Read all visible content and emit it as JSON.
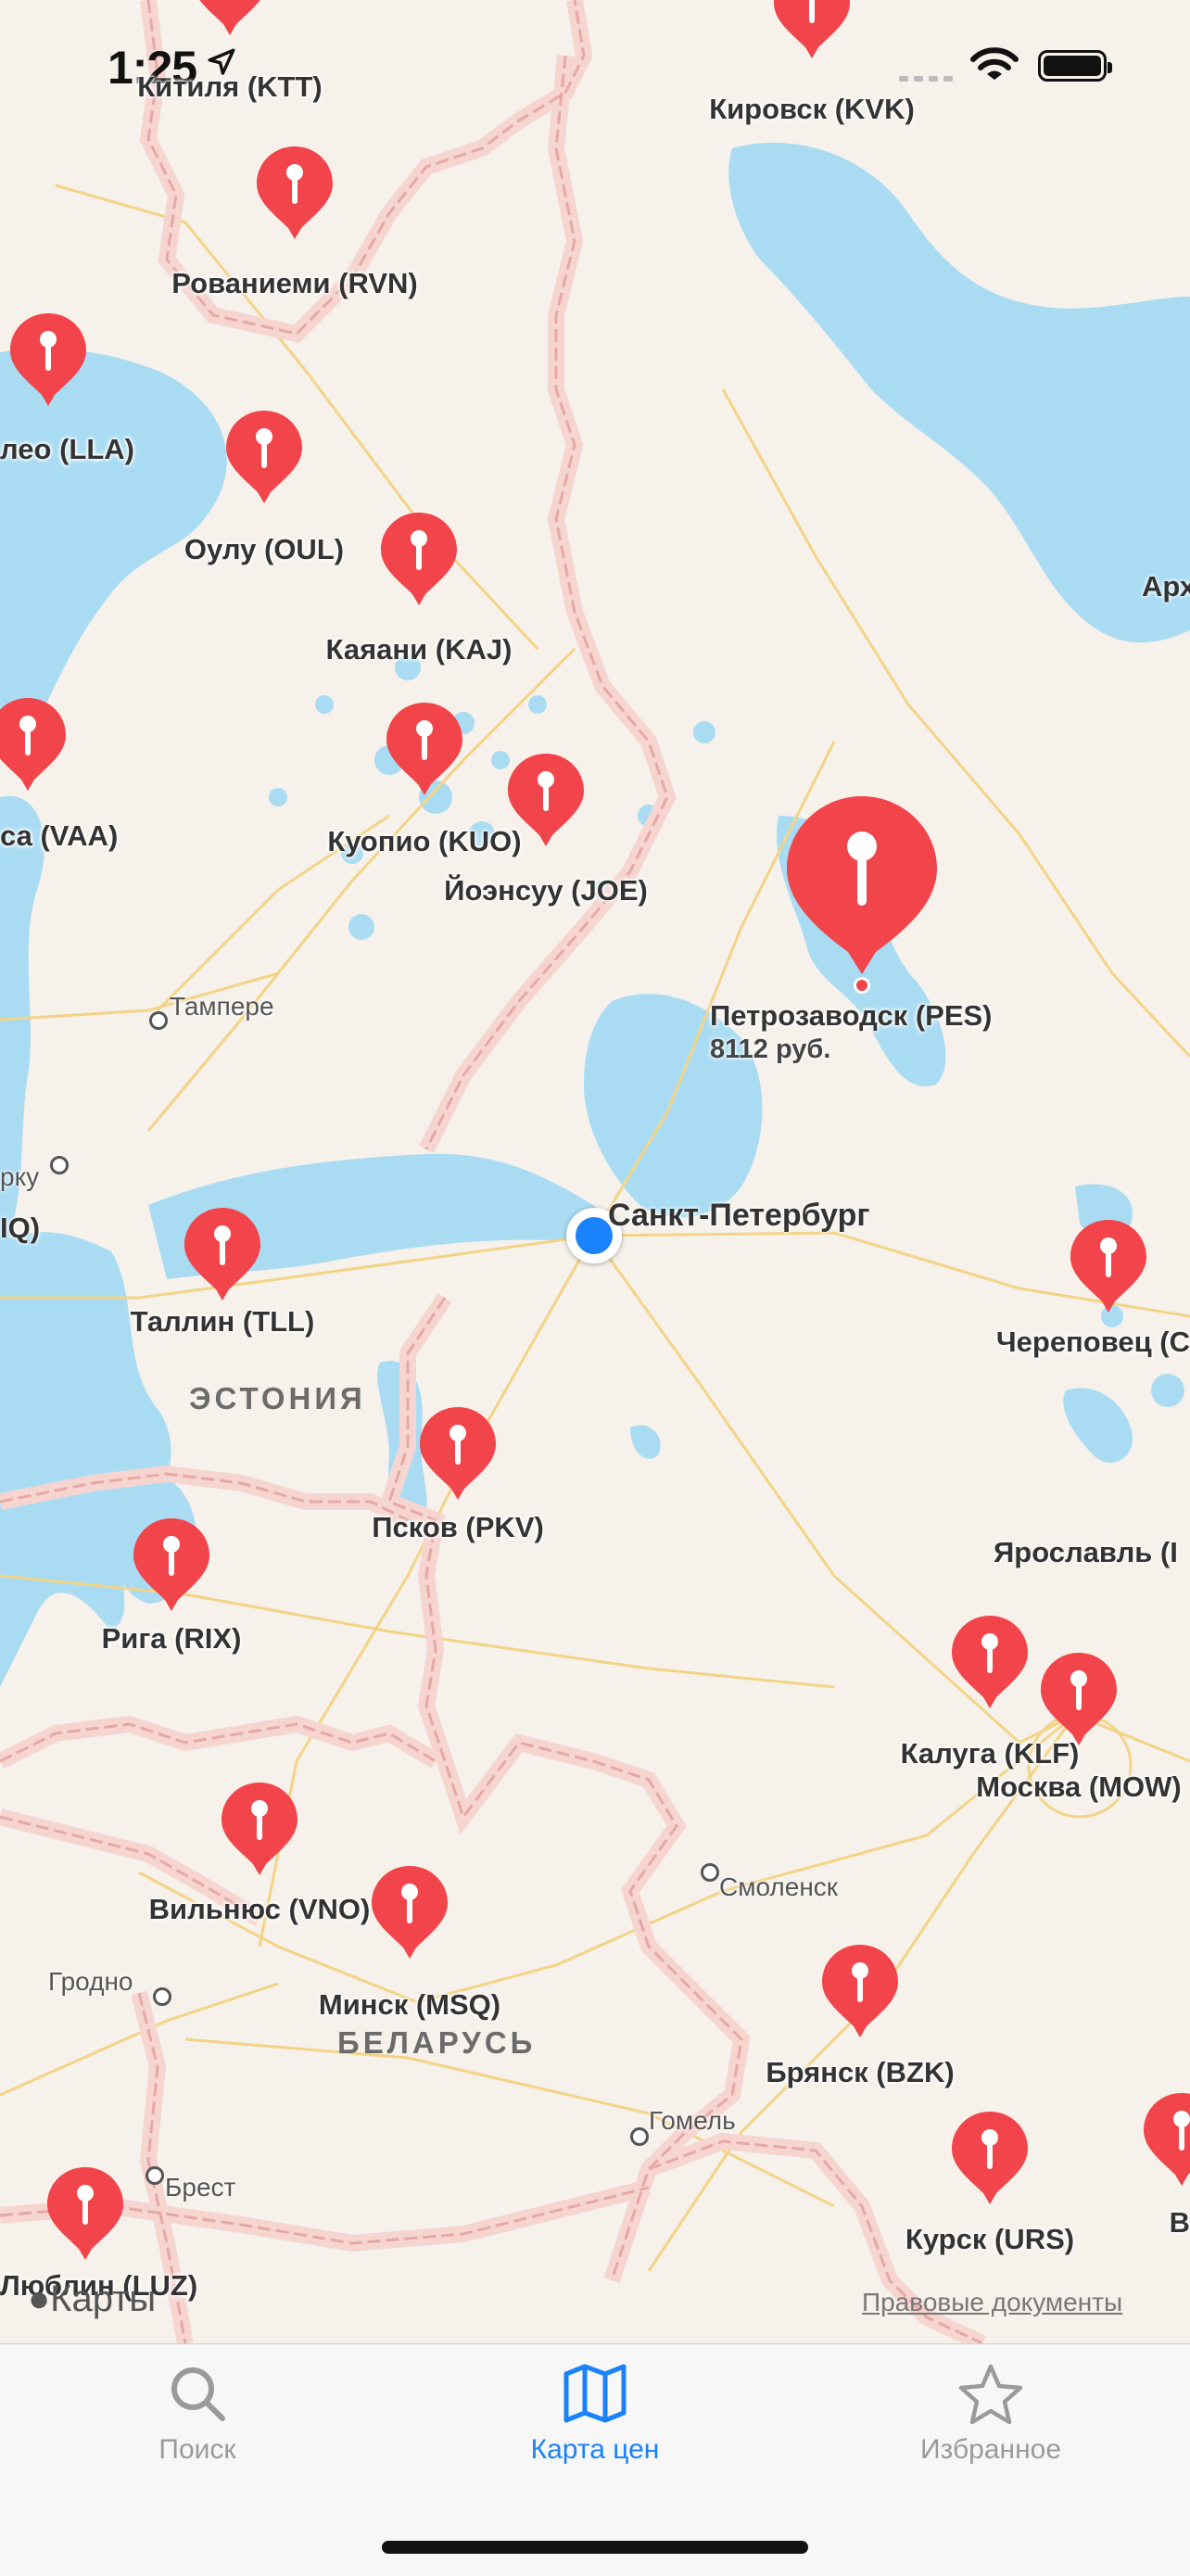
{
  "status_bar": {
    "time": "1:25"
  },
  "map": {
    "pins": [
      {
        "label": "Китиля (KTT)"
      },
      {
        "label": "Кировск (KVK)"
      },
      {
        "label": "Рованиеми (RVN)"
      },
      {
        "label": "леo (LLA)"
      },
      {
        "label": "Оулу (OUL)"
      },
      {
        "label": "Каяани (KAJ)"
      },
      {
        "label": "са (VAA)"
      },
      {
        "label": "Куопио (KUO)"
      },
      {
        "label": "Йоэнсуу (JOE)"
      },
      {
        "label": "Таллин (TLL)"
      },
      {
        "label": "Череповец (C"
      },
      {
        "label": "Псков (PKV)"
      },
      {
        "label": "Рига (RIX)"
      },
      {
        "label": "Москва (MOW)"
      },
      {
        "label": "Калуга (KLF)"
      },
      {
        "label": "Вильнюс (VNO)"
      },
      {
        "label": "Минск (MSQ)"
      },
      {
        "label": "Брянск (BZK)"
      },
      {
        "label": "Курск (URS)"
      },
      {
        "label": "Люблин (LUZ)"
      },
      {
        "label": "В"
      }
    ],
    "selected_pin": {
      "label": "Петрозаводск (PES)",
      "price": "8112 руб."
    },
    "city_labels": [
      {
        "label": "Тампере"
      },
      {
        "label": "рку"
      },
      {
        "label": "IQ)"
      },
      {
        "label": "Смоленск"
      },
      {
        "label": "Гродно"
      },
      {
        "label": "Гомель"
      },
      {
        "label": "Брест"
      },
      {
        "label": "Арх"
      },
      {
        "label": "Ярославль (I"
      }
    ],
    "major_city": "Санкт-Петербург",
    "countries": [
      "ЭСТОНИЯ",
      "БЕЛАРУСЬ"
    ],
    "maps_logo": "Карты",
    "legal_link": "Правовые документы"
  },
  "tab_bar": {
    "tabs": [
      {
        "label": "Поиск",
        "icon": "magnifier-icon",
        "active": false
      },
      {
        "label": "Карта цен",
        "icon": "map-icon",
        "active": true
      },
      {
        "label": "Избранное",
        "icon": "star-icon",
        "active": false
      }
    ]
  },
  "colors": {
    "pin": "#f2444b",
    "accent": "#1a82fb",
    "water": "#a9dcf3",
    "land": "#f6f1ea",
    "border": "#f4c9c5",
    "road": "#f3d486",
    "inactive_tab": "#9a9a9a"
  }
}
